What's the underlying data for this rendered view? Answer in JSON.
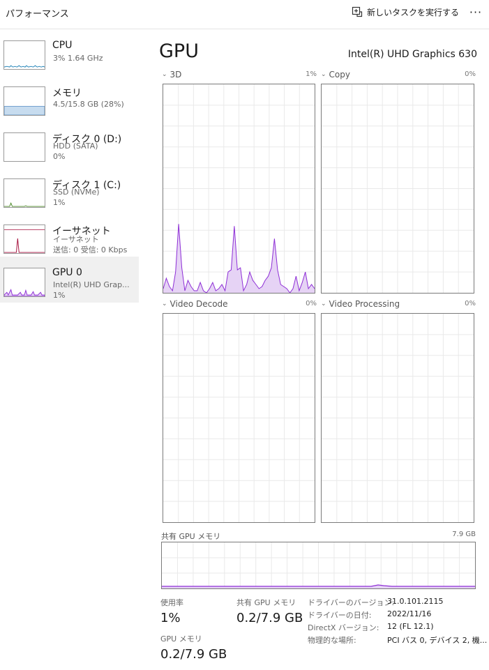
{
  "header": {
    "title": "パフォーマンス",
    "new_task_label": "新しいタスクを実行する",
    "more_label": "···"
  },
  "sidebar": {
    "items": [
      {
        "name": "CPU",
        "line1": "3%  1.64 GHz",
        "line2": ""
      },
      {
        "name": "メモリ",
        "line1": "4.5/15.8 GB (28%)",
        "line2": ""
      },
      {
        "name": "ディスク 0 (D:)",
        "line1": "HDD (SATA)",
        "line2": "0%"
      },
      {
        "name": "ディスク 1 (C:)",
        "line1": "SSD (NVMe)",
        "line2": "1%"
      },
      {
        "name": "イーサネット",
        "line1": "イーサネット",
        "line2": "送信: 0  受信: 0 Kbps"
      },
      {
        "name": "GPU 0",
        "line1": "Intel(R) UHD Grap...",
        "line2": "1%"
      }
    ]
  },
  "main": {
    "title": "GPU",
    "model": "Intel(R) UHD Graphics 630",
    "engines": [
      {
        "label": "3D",
        "percent": "1%"
      },
      {
        "label": "Copy",
        "percent": "0%"
      },
      {
        "label": "Video Decode",
        "percent": "0%"
      },
      {
        "label": "Video Processing",
        "percent": "0%"
      }
    ],
    "shared_memory": {
      "label": "共有 GPU メモリ",
      "max": "7.9 GB"
    },
    "stats": {
      "utilization_label": "使用率",
      "utilization_value": "1%",
      "shared_gpu_mem_label": "共有 GPU メモリ",
      "shared_gpu_mem_value": "0.2/7.9 GB",
      "gpu_mem_label": "GPU メモリ",
      "gpu_mem_value": "0.2/7.9 GB"
    },
    "info": [
      {
        "key": "ドライバーのバージョン:",
        "value": "31.0.101.2115"
      },
      {
        "key": "ドライバーの日付:",
        "value": "2022/11/16"
      },
      {
        "key": "DirectX バージョン:",
        "value": "12 (FL 12.1)"
      },
      {
        "key": "物理的な場所:",
        "value": "PCI バス 0, デバイス 2, 機..."
      }
    ]
  },
  "colors": {
    "gpu_line": "#8e2fd6",
    "gpu_fill": "#e6d3f5",
    "cpu_line": "#1a7fb5",
    "mem_fill": "#c7dcef",
    "disk_line": "#4d8a2a",
    "net_line": "#a50f3c"
  },
  "chart_data": {
    "type": "area",
    "title": "3D",
    "series": [
      {
        "values": [
          2,
          7,
          3,
          1,
          10,
          33,
          12,
          1,
          6,
          3,
          1,
          1,
          5,
          1,
          0,
          2,
          5,
          1,
          2,
          4,
          1,
          10,
          11,
          32,
          11,
          12,
          1,
          4,
          10,
          6,
          4,
          2,
          3,
          6,
          8,
          12,
          26,
          11,
          4,
          3,
          2,
          0,
          2,
          8,
          1,
          5,
          10,
          2,
          4,
          2
        ]
      }
    ],
    "ylim": [
      0,
      100
    ]
  }
}
